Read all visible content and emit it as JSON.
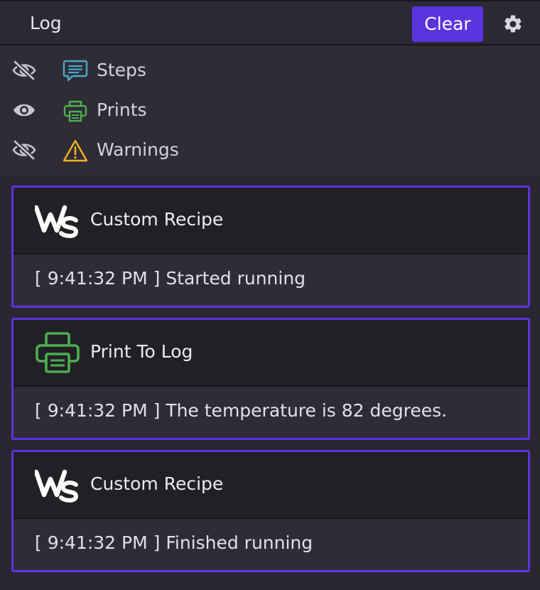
{
  "header": {
    "title": "Log",
    "clear_label": "Clear",
    "settings_icon": "gear-icon"
  },
  "filters": [
    {
      "label": "Steps",
      "visible": false,
      "icon": "speech-bubble-icon",
      "color": "#4aa8c8"
    },
    {
      "label": "Prints",
      "visible": true,
      "icon": "printer-icon",
      "color": "#4caf50"
    },
    {
      "label": "Warnings",
      "visible": false,
      "icon": "warning-triangle-icon",
      "color": "#f0b429"
    }
  ],
  "entries": [
    {
      "title": "Custom Recipe",
      "icon": "ws-logo-icon",
      "message": "[ 9:41:32 PM ] Started running"
    },
    {
      "title": "Print To Log",
      "icon": "printer-icon",
      "message": "[ 9:41:32 PM ] The temperature is 82 degrees."
    },
    {
      "title": "Custom Recipe",
      "icon": "ws-logo-icon",
      "message": "[ 9:41:32 PM ] Finished running"
    }
  ],
  "colors": {
    "accent": "#5b33e0",
    "background": "#2a2730",
    "card_header": "#222025"
  }
}
